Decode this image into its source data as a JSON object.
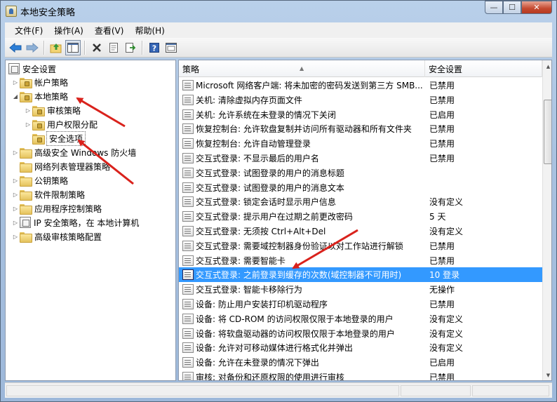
{
  "window": {
    "title": "本地安全策略",
    "min_glyph": "—",
    "max_glyph": "☐",
    "close_glyph": "✕"
  },
  "menu": [
    "文件(F)",
    "操作(A)",
    "查看(V)",
    "帮助(H)"
  ],
  "toolbar_icons": [
    "back-arrow-icon",
    "forward-arrow-icon",
    "up-folder-icon",
    "show-tree-icon",
    "delete-icon",
    "properties-icon",
    "export-list-icon",
    "help-icon",
    "console-view-icon"
  ],
  "tree": {
    "root": "安全设置",
    "items": [
      {
        "label": "帐户策略",
        "expander": "▷"
      },
      {
        "label": "本地策略",
        "expander": "◢"
      },
      {
        "label": "审核策略",
        "expander": "▷"
      },
      {
        "label": "用户权限分配",
        "expander": "▷"
      },
      {
        "label": "安全选项",
        "expander": ""
      },
      {
        "label": "高级安全 Windows 防火墙",
        "expander": "▷"
      },
      {
        "label": "网络列表管理器策略",
        "expander": ""
      },
      {
        "label": "公钥策略",
        "expander": "▷"
      },
      {
        "label": "软件限制策略",
        "expander": "▷"
      },
      {
        "label": "应用程序控制策略",
        "expander": "▷"
      },
      {
        "label": "IP 安全策略，在 本地计算机",
        "expander": "▷"
      },
      {
        "label": "高级审核策略配置",
        "expander": "▷"
      }
    ]
  },
  "list": {
    "columns": [
      "策略",
      "安全设置"
    ],
    "rows": [
      {
        "policy": "Microsoft 网络客户端: 将未加密的密码发送到第三方 SMB...",
        "setting": "已禁用"
      },
      {
        "policy": "关机: 清除虚拟内存页面文件",
        "setting": "已禁用"
      },
      {
        "policy": "关机: 允许系统在未登录的情况下关闭",
        "setting": "已启用"
      },
      {
        "policy": "恢复控制台: 允许软盘复制并访问所有驱动器和所有文件夹",
        "setting": "已禁用"
      },
      {
        "policy": "恢复控制台: 允许自动管理登录",
        "setting": "已禁用"
      },
      {
        "policy": "交互式登录: 不显示最后的用户名",
        "setting": "已禁用"
      },
      {
        "policy": "交互式登录: 试图登录的用户的消息标题",
        "setting": ""
      },
      {
        "policy": "交互式登录: 试图登录的用户的消息文本",
        "setting": ""
      },
      {
        "policy": "交互式登录: 锁定会话时显示用户信息",
        "setting": "没有定义"
      },
      {
        "policy": "交互式登录: 提示用户在过期之前更改密码",
        "setting": "5 天"
      },
      {
        "policy": "交互式登录: 无须按 Ctrl+Alt+Del",
        "setting": "没有定义"
      },
      {
        "policy": "交互式登录: 需要域控制器身份验证以对工作站进行解锁",
        "setting": "已禁用"
      },
      {
        "policy": "交互式登录: 需要智能卡",
        "setting": "已禁用"
      },
      {
        "policy": "交互式登录: 之前登录到缓存的次数(域控制器不可用时)",
        "setting": "10 登录"
      },
      {
        "policy": "交互式登录: 智能卡移除行为",
        "setting": "无操作"
      },
      {
        "policy": "设备: 防止用户安装打印机驱动程序",
        "setting": "已禁用"
      },
      {
        "policy": "设备: 将 CD-ROM 的访问权限仅限于本地登录的用户",
        "setting": "没有定义"
      },
      {
        "policy": "设备: 将软盘驱动器的访问权限仅限于本地登录的用户",
        "setting": "没有定义"
      },
      {
        "policy": "设备: 允许对可移动媒体进行格式化并弹出",
        "setting": "没有定义"
      },
      {
        "policy": "设备: 允许在未登录的情况下弹出",
        "setting": "已启用"
      },
      {
        "policy": "审核: 对备份和还原权限的使用进行审核",
        "setting": "已禁用"
      }
    ],
    "selected_index": 13
  },
  "colors": {
    "selection": "#3399ff",
    "annotation_arrow": "#d9221c"
  }
}
